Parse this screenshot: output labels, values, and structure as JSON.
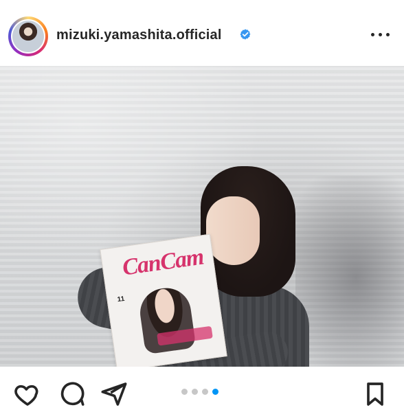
{
  "post": {
    "username": "mizuki.yamashita.official",
    "verified": true
  },
  "magazine": {
    "title": "CanCam",
    "issue": "11"
  },
  "carousel": {
    "total": 4,
    "active_index": 3
  },
  "icons": {
    "verified": "verified-badge-icon",
    "more": "more-options-icon",
    "like": "heart-icon",
    "comment": "comment-icon",
    "share": "share-icon",
    "save": "bookmark-icon"
  },
  "colors": {
    "verified": "#3897f0",
    "active_dot": "#0095f6",
    "inactive_dot": "#c7c7c7"
  }
}
